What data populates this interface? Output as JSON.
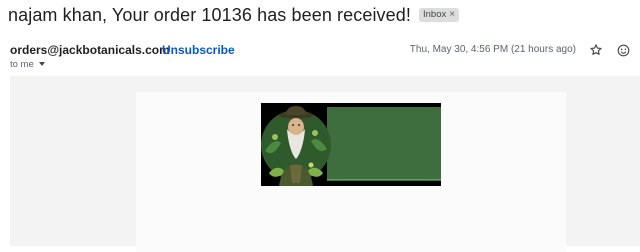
{
  "email": {
    "subject": "najam khan, Your order 10136 has been received!",
    "label": "Inbox",
    "label_remove_glyph": "×",
    "sender": "orders@jackbotanicals.com",
    "unsubscribe": "Unsubscribe",
    "timestamp": "Thu, May 30, 4:56 PM (21 hours ago)",
    "recipient": "to me"
  },
  "icons": {
    "star": "star-outline-icon",
    "emoji": "add-reaction-icon",
    "recipient_caret": "caret-down-icon"
  },
  "colors": {
    "link": "#0b57d0",
    "banner_green": "#3f6e3e",
    "panel_bg": "#f3f3f3"
  }
}
